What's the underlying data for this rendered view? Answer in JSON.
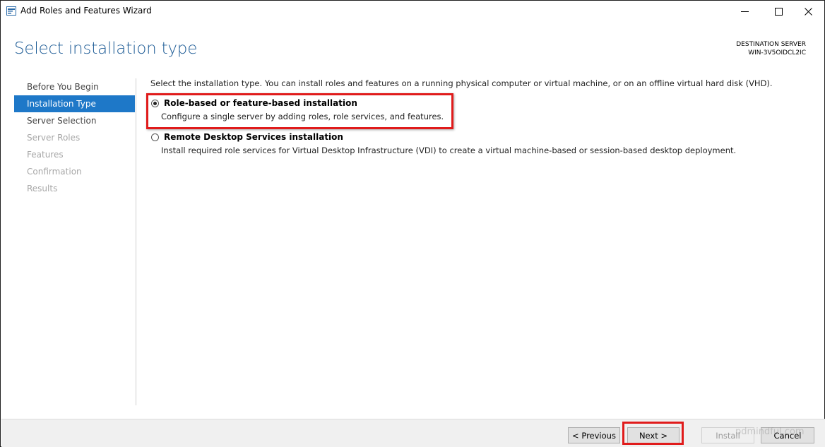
{
  "window": {
    "title": "Add Roles and Features Wizard"
  },
  "header": {
    "page_title": "Select installation type",
    "destination_label": "DESTINATION SERVER",
    "destination_server": "WIN-3V5OIDCL2IC"
  },
  "nav": {
    "items": [
      {
        "label": "Before You Begin",
        "state": "normal"
      },
      {
        "label": "Installation Type",
        "state": "active"
      },
      {
        "label": "Server Selection",
        "state": "normal"
      },
      {
        "label": "Server Roles",
        "state": "disabled"
      },
      {
        "label": "Features",
        "state": "disabled"
      },
      {
        "label": "Confirmation",
        "state": "disabled"
      },
      {
        "label": "Results",
        "state": "disabled"
      }
    ]
  },
  "content": {
    "intro": "Select the installation type. You can install roles and features on a running physical computer or virtual machine, or on an offline virtual hard disk (VHD).",
    "options": [
      {
        "title": "Role-based or feature-based installation",
        "description": "Configure a single server by adding roles, role services, and features.",
        "selected": true
      },
      {
        "title": "Remote Desktop Services installation",
        "description": "Install required role services for Virtual Desktop Infrastructure (VDI) to create a virtual machine-based or session-based desktop deployment.",
        "selected": false
      }
    ]
  },
  "footer": {
    "previous_label": "< Previous",
    "next_label": "Next >",
    "install_label": "Install",
    "cancel_label": "Cancel"
  },
  "watermark": "pdmindful.com",
  "colors": {
    "title_blue": "#1e5c96",
    "nav_active": "#1e78c8",
    "highlight_red": "#e01b1b"
  }
}
